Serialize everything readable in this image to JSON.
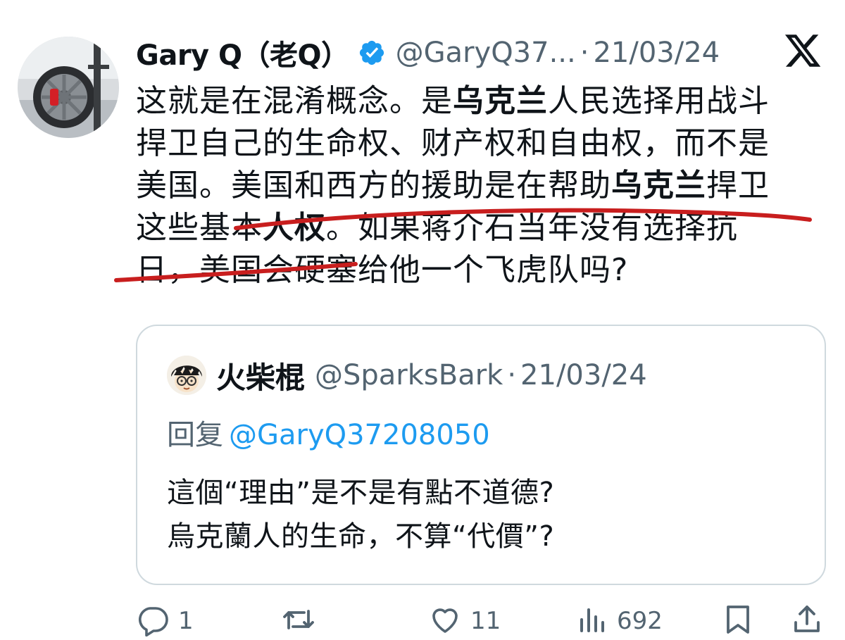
{
  "tweet": {
    "author": {
      "name": "Gary Q（老Q）",
      "handle": "@GaryQ37...",
      "verified_icon": "verified-badge-icon",
      "avatar": "car-wheel-photo"
    },
    "separator": "·",
    "date": "21/03/24",
    "platform_logo": "x-logo-icon",
    "text": {
      "line1_a": "这就是在混淆概念。是",
      "line1_b": "乌克兰",
      "line1_c": "人民选择用战斗",
      "line2": "捍卫自己的生命权、财产权和自由权，而不是",
      "line3_a": "美国。美国和西方的援助是在帮助",
      "line3_b": "乌克兰",
      "line3_c": "捍卫",
      "line4_a": "这些基本",
      "line4_b": "人权",
      "line4_c": "。如果蒋介石当年没有选择抗",
      "line5": "日，美国会硬塞给他一个飞虎队吗?"
    },
    "annotation_color": "#c81e1e"
  },
  "quote": {
    "author": {
      "name": "火柴棍",
      "handle": "@SparksBark",
      "avatar": "cartoon-avatar"
    },
    "separator": "·",
    "date": "21/03/24",
    "reply_label": "回复",
    "reply_mention": "@GaryQ37208050",
    "body": {
      "line1": "這個“理由”是不是有點不道德?",
      "line2": "烏克蘭人的生命，不算“代價”?"
    }
  },
  "actions": {
    "reply": {
      "icon": "reply-icon",
      "count": "1"
    },
    "retweet": {
      "icon": "retweet-icon",
      "count": ""
    },
    "like": {
      "icon": "heart-icon",
      "count": "11"
    },
    "views": {
      "icon": "views-icon",
      "count": "692"
    },
    "bookmark": {
      "icon": "bookmark-icon"
    },
    "share": {
      "icon": "share-icon"
    }
  },
  "colors": {
    "text": "#0f1419",
    "secondary": "#536471",
    "link": "#1d9bf0",
    "verified": "#1d9bf0",
    "border": "#cfd9de"
  }
}
